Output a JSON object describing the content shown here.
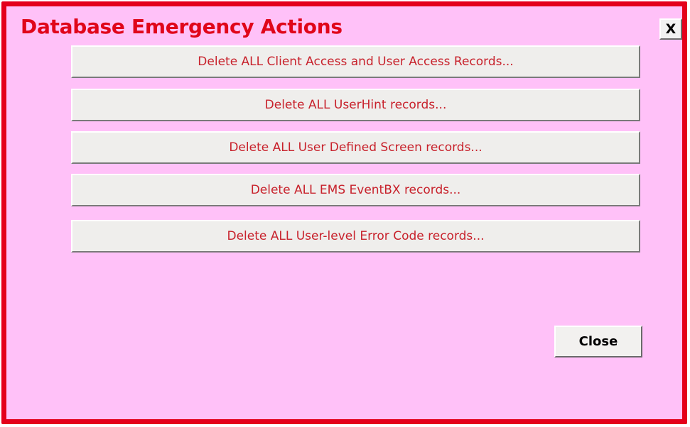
{
  "window": {
    "title": "Database Emergency Actions",
    "close_x_label": "X"
  },
  "actions": [
    {
      "label": "Delete ALL Client Access and User Access Records..."
    },
    {
      "label": "Delete ALL UserHint records..."
    },
    {
      "label": "Delete ALL User Defined Screen records..."
    },
    {
      "label": "Delete ALL EMS EventBX records..."
    },
    {
      "label": "Delete ALL User-level Error Code records..."
    }
  ],
  "footer": {
    "close_label": "Close"
  },
  "colors": {
    "background": "#ffc1f8",
    "border": "#e4001b",
    "title": "#e0061a",
    "action_text": "#c8222c",
    "button_face": "#efeeec"
  }
}
